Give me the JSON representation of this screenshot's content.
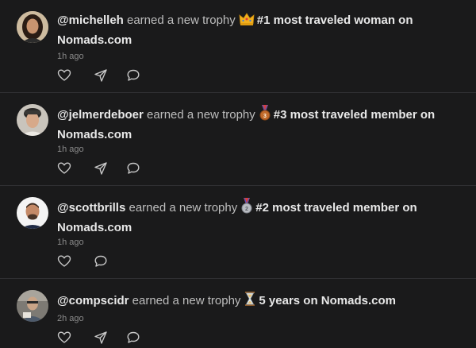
{
  "feed": {
    "posts": [
      {
        "handle": "@michelleh",
        "action": "earned a new trophy",
        "trophy_icon": "crown-icon",
        "trophy_title": "#1 most traveled woman on",
        "trophy_title_2": "Nomads.com",
        "time": "1h ago"
      },
      {
        "handle": "@jelmerdeboer",
        "action": "earned a new trophy",
        "trophy_icon": "bronze-medal-icon",
        "trophy_title": "#3 most traveled member on",
        "trophy_title_2": "Nomads.com",
        "time": "1h ago"
      },
      {
        "handle": "@scottbrills",
        "action": "earned a new trophy",
        "trophy_icon": "silver-medal-icon",
        "trophy_title": "#2 most traveled member on",
        "trophy_title_2": "Nomads.com",
        "time": "1h ago"
      },
      {
        "handle": "@compscidr",
        "action": "earned a new trophy",
        "trophy_icon": "hourglass-icon",
        "trophy_title": "5 years on Nomads.com",
        "trophy_title_2": "",
        "time": "2h ago"
      }
    ]
  },
  "colors": {
    "background": "#1a1a1b",
    "divider": "#303033",
    "text_primary": "#e8e8e8",
    "text_secondary": "#bdbdbd",
    "text_muted": "#8a8a8a",
    "icon": "#c8c8c8"
  }
}
